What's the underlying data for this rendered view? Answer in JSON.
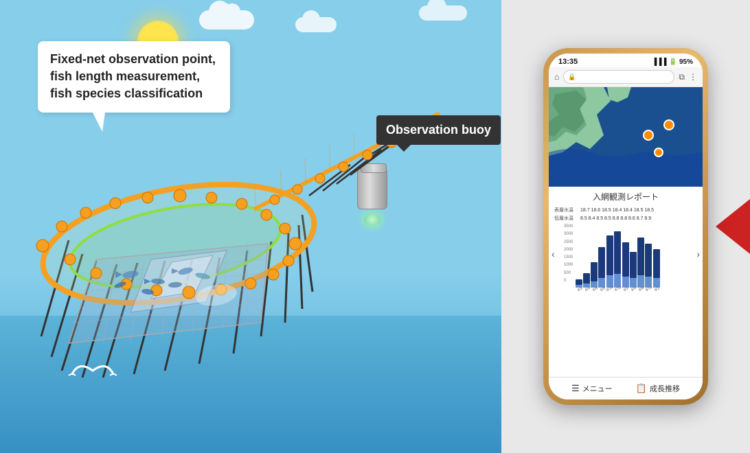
{
  "left_panel": {
    "callout_main": {
      "text": "Fixed-net observation point, fish length measurement, fish species classification"
    },
    "callout_buoy": {
      "text": "Observation buoy"
    }
  },
  "phone": {
    "status_bar": {
      "time": "13:35",
      "signal": "📶",
      "battery_pct": "95%"
    },
    "report_title": "入網観測レポート",
    "surface_temp_label": "表層水温",
    "surface_temps": "18.7  18.6  18.5  18.4  18.4  18.5  18.5",
    "bottom_temp_label": "低層水温",
    "bottom_temps": "8.5  8.4  8.5  8.5  8.8  8.8  8.6  8.7  8.9",
    "y_axis_labels": [
      "3500",
      "3000",
      "2500",
      "2000",
      "1500",
      "1000",
      "500",
      "0"
    ],
    "bars": [
      {
        "label": "8/2",
        "dark": 10,
        "light": 5
      },
      {
        "label": "8/4",
        "dark": 20,
        "light": 8
      },
      {
        "label": "8/6",
        "dark": 35,
        "light": 12
      },
      {
        "label": "8/8",
        "dark": 55,
        "light": 18
      },
      {
        "label": "8/10",
        "dark": 70,
        "light": 25
      },
      {
        "label": "8/12",
        "dark": 75,
        "light": 28
      },
      {
        "label": "9/2",
        "dark": 60,
        "light": 22
      },
      {
        "label": "9/4",
        "dark": 45,
        "light": 18
      },
      {
        "label": "9/6",
        "dark": 65,
        "light": 24
      },
      {
        "label": "9/12",
        "dark": 58,
        "light": 20
      },
      {
        "label": "9/2",
        "dark": 50,
        "light": 18
      }
    ],
    "nav_menu_label": "メニュー",
    "nav_growth_label": "成長推移"
  }
}
